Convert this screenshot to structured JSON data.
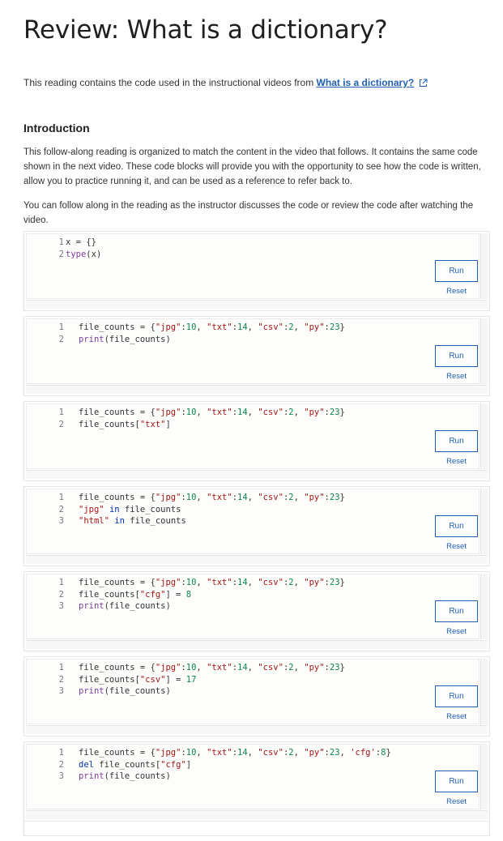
{
  "page": {
    "title": "Review: What is a dictionary?",
    "intro_prefix": "This reading contains the code used in the instructional videos from ",
    "intro_link": "What is a dictionary?",
    "section_heading": "Introduction",
    "paragraph1": "This follow-along reading is organized to match the content in the video that follows. It contains the same code shown in the next video. These code blocks will provide you with the opportunity to see how the code is written, allow you to practice running it, and can be used as a reference to refer back to.",
    "paragraph2": "You can follow along in the reading as the instructor discusses the code or review the code after watching the video."
  },
  "buttons": {
    "run": "Run",
    "reset": "Reset"
  },
  "cells": [
    {
      "lines": [
        [
          {
            "t": "x = {}",
            "c": ""
          }
        ],
        [
          {
            "t": "type",
            "c": "fn"
          },
          {
            "t": "(x)",
            "c": ""
          }
        ]
      ],
      "indent": "small"
    },
    {
      "lines": [
        [
          {
            "t": "file_counts = {",
            "c": ""
          },
          {
            "t": "\"jpg\"",
            "c": "str"
          },
          {
            "t": ":",
            "c": ""
          },
          {
            "t": "10",
            "c": "num"
          },
          {
            "t": ", ",
            "c": ""
          },
          {
            "t": "\"txt\"",
            "c": "str"
          },
          {
            "t": ":",
            "c": ""
          },
          {
            "t": "14",
            "c": "num"
          },
          {
            "t": ", ",
            "c": ""
          },
          {
            "t": "\"csv\"",
            "c": "str"
          },
          {
            "t": ":",
            "c": ""
          },
          {
            "t": "2",
            "c": "num"
          },
          {
            "t": ", ",
            "c": ""
          },
          {
            "t": "\"py\"",
            "c": "str"
          },
          {
            "t": ":",
            "c": ""
          },
          {
            "t": "23",
            "c": "num"
          },
          {
            "t": "}",
            "c": ""
          }
        ],
        [
          {
            "t": "print",
            "c": "fn"
          },
          {
            "t": "(file_counts)",
            "c": ""
          }
        ]
      ]
    },
    {
      "lines": [
        [
          {
            "t": "file_counts = {",
            "c": ""
          },
          {
            "t": "\"jpg\"",
            "c": "str"
          },
          {
            "t": ":",
            "c": ""
          },
          {
            "t": "10",
            "c": "num"
          },
          {
            "t": ", ",
            "c": ""
          },
          {
            "t": "\"txt\"",
            "c": "str"
          },
          {
            "t": ":",
            "c": ""
          },
          {
            "t": "14",
            "c": "num"
          },
          {
            "t": ", ",
            "c": ""
          },
          {
            "t": "\"csv\"",
            "c": "str"
          },
          {
            "t": ":",
            "c": ""
          },
          {
            "t": "2",
            "c": "num"
          },
          {
            "t": ", ",
            "c": ""
          },
          {
            "t": "\"py\"",
            "c": "str"
          },
          {
            "t": ":",
            "c": ""
          },
          {
            "t": "23",
            "c": "num"
          },
          {
            "t": "}",
            "c": ""
          }
        ],
        [
          {
            "t": "file_counts[",
            "c": ""
          },
          {
            "t": "\"txt\"",
            "c": "str"
          },
          {
            "t": "]",
            "c": ""
          }
        ]
      ]
    },
    {
      "lines": [
        [
          {
            "t": "file_counts = {",
            "c": ""
          },
          {
            "t": "\"jpg\"",
            "c": "str"
          },
          {
            "t": ":",
            "c": ""
          },
          {
            "t": "10",
            "c": "num"
          },
          {
            "t": ", ",
            "c": ""
          },
          {
            "t": "\"txt\"",
            "c": "str"
          },
          {
            "t": ":",
            "c": ""
          },
          {
            "t": "14",
            "c": "num"
          },
          {
            "t": ", ",
            "c": ""
          },
          {
            "t": "\"csv\"",
            "c": "str"
          },
          {
            "t": ":",
            "c": ""
          },
          {
            "t": "2",
            "c": "num"
          },
          {
            "t": ", ",
            "c": ""
          },
          {
            "t": "\"py\"",
            "c": "str"
          },
          {
            "t": ":",
            "c": ""
          },
          {
            "t": "23",
            "c": "num"
          },
          {
            "t": "}",
            "c": ""
          }
        ],
        [
          {
            "t": "\"jpg\"",
            "c": "str"
          },
          {
            "t": " ",
            "c": ""
          },
          {
            "t": "in",
            "c": "op"
          },
          {
            "t": " file_counts",
            "c": ""
          }
        ],
        [
          {
            "t": "\"html\"",
            "c": "str"
          },
          {
            "t": " ",
            "c": ""
          },
          {
            "t": "in",
            "c": "op"
          },
          {
            "t": " file_counts",
            "c": ""
          }
        ]
      ]
    },
    {
      "lines": [
        [
          {
            "t": "file_counts = {",
            "c": ""
          },
          {
            "t": "\"jpg\"",
            "c": "str"
          },
          {
            "t": ":",
            "c": ""
          },
          {
            "t": "10",
            "c": "num"
          },
          {
            "t": ", ",
            "c": ""
          },
          {
            "t": "\"txt\"",
            "c": "str"
          },
          {
            "t": ":",
            "c": ""
          },
          {
            "t": "14",
            "c": "num"
          },
          {
            "t": ", ",
            "c": ""
          },
          {
            "t": "\"csv\"",
            "c": "str"
          },
          {
            "t": ":",
            "c": ""
          },
          {
            "t": "2",
            "c": "num"
          },
          {
            "t": ", ",
            "c": ""
          },
          {
            "t": "\"py\"",
            "c": "str"
          },
          {
            "t": ":",
            "c": ""
          },
          {
            "t": "23",
            "c": "num"
          },
          {
            "t": "}",
            "c": ""
          }
        ],
        [
          {
            "t": "file_counts[",
            "c": ""
          },
          {
            "t": "\"cfg\"",
            "c": "str"
          },
          {
            "t": "] = ",
            "c": ""
          },
          {
            "t": "8",
            "c": "num"
          }
        ],
        [
          {
            "t": "print",
            "c": "fn"
          },
          {
            "t": "(file_counts)",
            "c": ""
          }
        ]
      ]
    },
    {
      "lines": [
        [
          {
            "t": "file_counts = {",
            "c": ""
          },
          {
            "t": "\"jpg\"",
            "c": "str"
          },
          {
            "t": ":",
            "c": ""
          },
          {
            "t": "10",
            "c": "num"
          },
          {
            "t": ", ",
            "c": ""
          },
          {
            "t": "\"txt\"",
            "c": "str"
          },
          {
            "t": ":",
            "c": ""
          },
          {
            "t": "14",
            "c": "num"
          },
          {
            "t": ", ",
            "c": ""
          },
          {
            "t": "\"csv\"",
            "c": "str"
          },
          {
            "t": ":",
            "c": ""
          },
          {
            "t": "2",
            "c": "num"
          },
          {
            "t": ", ",
            "c": ""
          },
          {
            "t": "\"py\"",
            "c": "str"
          },
          {
            "t": ":",
            "c": ""
          },
          {
            "t": "23",
            "c": "num"
          },
          {
            "t": "}",
            "c": ""
          }
        ],
        [
          {
            "t": "file_counts[",
            "c": ""
          },
          {
            "t": "\"csv\"",
            "c": "str"
          },
          {
            "t": "] = ",
            "c": ""
          },
          {
            "t": "17",
            "c": "num"
          }
        ],
        [
          {
            "t": "print",
            "c": "fn"
          },
          {
            "t": "(file_counts)",
            "c": ""
          }
        ]
      ]
    },
    {
      "lines": [
        [
          {
            "t": "file_counts = {",
            "c": ""
          },
          {
            "t": "\"jpg\"",
            "c": "str"
          },
          {
            "t": ":",
            "c": ""
          },
          {
            "t": "10",
            "c": "num"
          },
          {
            "t": ", ",
            "c": ""
          },
          {
            "t": "\"txt\"",
            "c": "str"
          },
          {
            "t": ":",
            "c": ""
          },
          {
            "t": "14",
            "c": "num"
          },
          {
            "t": ", ",
            "c": ""
          },
          {
            "t": "\"csv\"",
            "c": "str"
          },
          {
            "t": ":",
            "c": ""
          },
          {
            "t": "2",
            "c": "num"
          },
          {
            "t": ", ",
            "c": ""
          },
          {
            "t": "\"py\"",
            "c": "str"
          },
          {
            "t": ":",
            "c": ""
          },
          {
            "t": "23",
            "c": "num"
          },
          {
            "t": ", ",
            "c": ""
          },
          {
            "t": "'cfg'",
            "c": "str"
          },
          {
            "t": ":",
            "c": ""
          },
          {
            "t": "8",
            "c": "num"
          },
          {
            "t": "}",
            "c": ""
          }
        ],
        [
          {
            "t": "del",
            "c": "op"
          },
          {
            "t": " file_counts[",
            "c": ""
          },
          {
            "t": "\"cfg\"",
            "c": "str"
          },
          {
            "t": "]",
            "c": ""
          }
        ],
        [
          {
            "t": "print",
            "c": "fn"
          },
          {
            "t": "(file_counts)",
            "c": ""
          }
        ]
      ]
    }
  ],
  "colors": {
    "link": "#1f5fb4",
    "string": "#a31515",
    "function": "#7a3e9d",
    "number": "#098658",
    "keyword": "#0033b3"
  }
}
